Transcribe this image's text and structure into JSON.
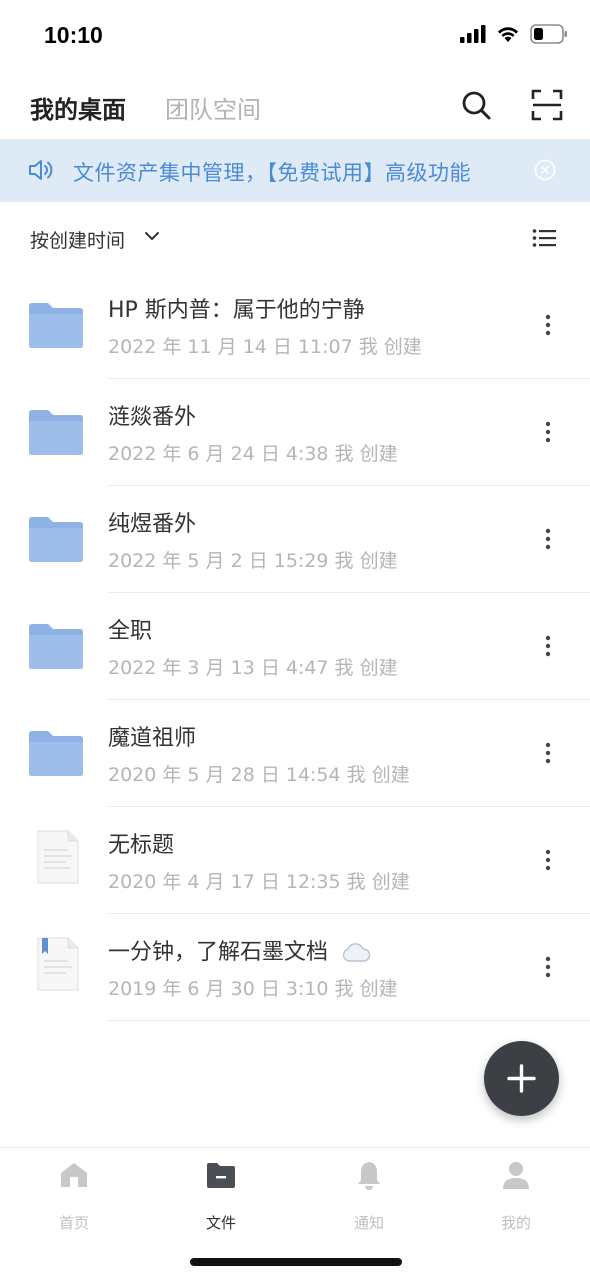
{
  "status": {
    "time": "10:10"
  },
  "header": {
    "tab_main": "我的桌面",
    "tab_team": "团队空间"
  },
  "banner": {
    "text": "文件资产集中管理，【免费试用】高级功能"
  },
  "sort": {
    "label": "按创建时间"
  },
  "files": [
    {
      "type": "folder",
      "name": "HP 斯内普：属于他的宁静",
      "meta": "2022 年 11 月 14 日 11:07 我 创建"
    },
    {
      "type": "folder",
      "name": "涟燚番外",
      "meta": "2022 年 6 月 24 日 4:38 我 创建"
    },
    {
      "type": "folder",
      "name": "纯煜番外",
      "meta": "2022 年 5 月 2 日 15:29 我 创建"
    },
    {
      "type": "folder",
      "name": "全职",
      "meta": "2022 年 3 月 13 日 4:47 我 创建"
    },
    {
      "type": "folder",
      "name": "魔道祖师",
      "meta": "2020 年 5 月 28 日 14:54 我 创建"
    },
    {
      "type": "doc",
      "name": "无标题",
      "meta": "2020 年 4 月 17 日 12:35 我 创建"
    },
    {
      "type": "doc-bookmark",
      "name": "一分钟，了解石墨文档",
      "meta": "2019 年 6 月 30 日 3:10 我 创建",
      "cloud_icon": true
    }
  ],
  "nav": {
    "home": "首页",
    "files": "文件",
    "notify": "通知",
    "me": "我的"
  },
  "colors": {
    "banner_bg": "#dfeaf7",
    "banner_text": "#4a8bd6",
    "folder": "#8fb2e4",
    "fab": "#3c4045"
  }
}
